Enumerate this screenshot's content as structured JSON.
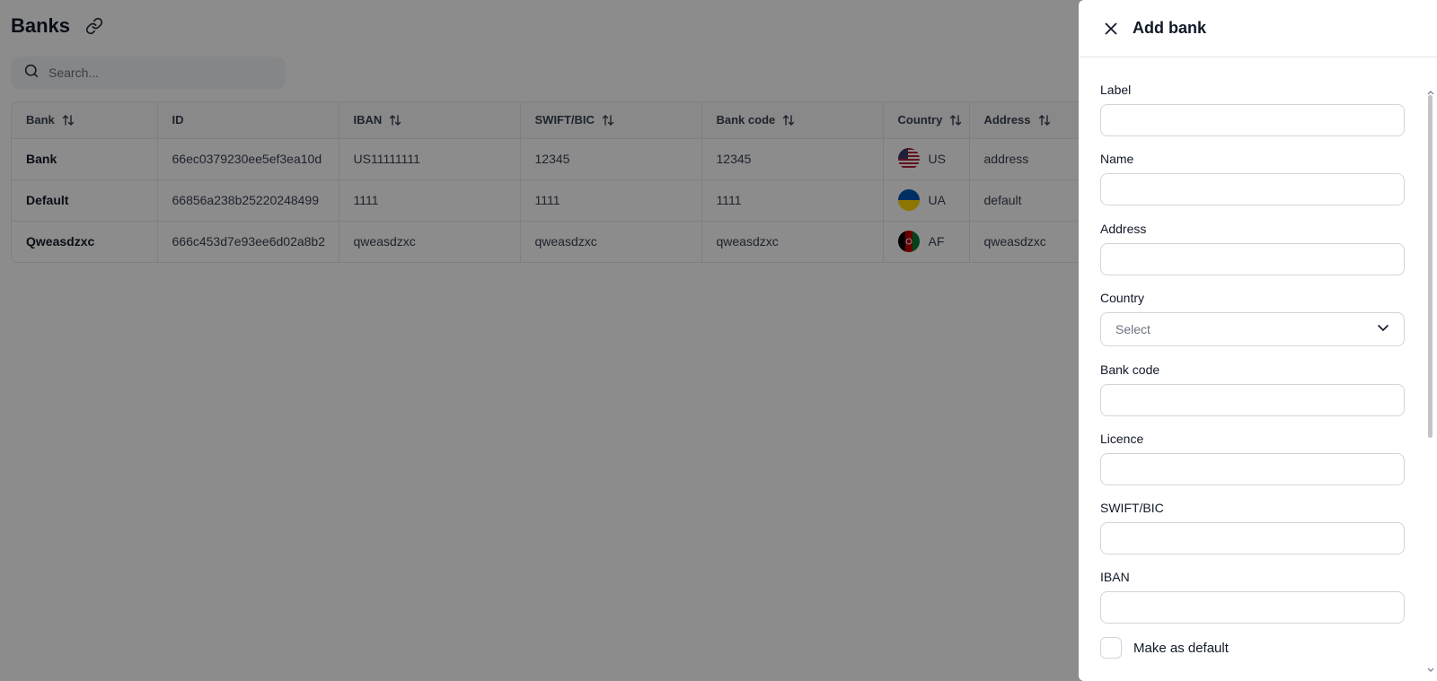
{
  "page": {
    "title": "Banks",
    "search_placeholder": "Search..."
  },
  "table": {
    "columns": [
      {
        "label": "Bank",
        "sortable": true
      },
      {
        "label": "ID",
        "sortable": false
      },
      {
        "label": "IBAN",
        "sortable": true
      },
      {
        "label": "SWIFT/BIC",
        "sortable": true
      },
      {
        "label": "Bank code",
        "sortable": true
      },
      {
        "label": "Country",
        "sortable": true
      },
      {
        "label": "Address",
        "sortable": true
      }
    ],
    "rows": [
      {
        "bank": "Bank",
        "id": "66ec0379230ee5ef3ea10d",
        "iban": "US11111111",
        "swift": "12345",
        "bank_code": "12345",
        "country": "US",
        "flag": "us-flag-icon",
        "address": "address"
      },
      {
        "bank": "Default",
        "id": "66856a238b25220248499",
        "iban": "1111",
        "swift": "1111",
        "bank_code": "1111",
        "country": "UA",
        "flag": "ua-flag-icon",
        "address": "default"
      },
      {
        "bank": "Qweasdzxc",
        "id": "666c453d7e93ee6d02a8b2",
        "iban": "qweasdzxc",
        "swift": "qweasdzxc",
        "bank_code": "qweasdzxc",
        "country": "AF",
        "flag": "af-flag-icon",
        "address": "qweasdzxc"
      }
    ]
  },
  "drawer": {
    "title": "Add bank",
    "fields": {
      "label": "Label",
      "name": "Name",
      "address": "Address",
      "country": "Country",
      "country_value": "Select",
      "bank_code": "Bank code",
      "licence": "Licence",
      "swift": "SWIFT/BIC",
      "iban": "IBAN"
    },
    "default_checkbox_label": "Make as default"
  },
  "colors": {
    "overlay": "#000000",
    "border": "#d1d5db",
    "text": "#111827"
  }
}
